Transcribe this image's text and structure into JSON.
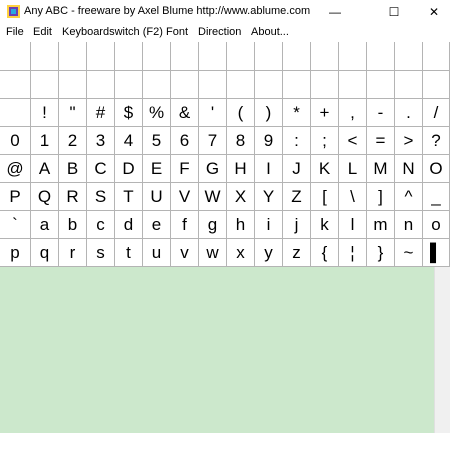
{
  "window": {
    "title": "Any ABC - freeware by Axel Blume http://www.ablume.com",
    "controls": {
      "minimize": "—",
      "maximize": "☐",
      "close": "✕"
    }
  },
  "menu": [
    "File",
    "Edit",
    "Keyboardswitch (F2)",
    "Font",
    "Direction",
    "About..."
  ],
  "grid": {
    "rows": [
      [
        "",
        "",
        "",
        "",
        "",
        "",
        "",
        "",
        "",
        "",
        "",
        "",
        "",
        "",
        "",
        ""
      ],
      [
        "",
        "",
        "",
        "",
        "",
        "",
        "",
        "",
        "",
        "",
        "",
        "",
        "",
        "",
        "",
        ""
      ],
      [
        "",
        "!",
        "\"",
        "#",
        "$",
        "%",
        "&",
        "'",
        "(",
        ")",
        "*",
        "+",
        ",",
        "-",
        ".",
        "/"
      ],
      [
        "0",
        "1",
        "2",
        "3",
        "4",
        "5",
        "6",
        "7",
        "8",
        "9",
        ":",
        ";",
        "<",
        "=",
        ">",
        "?"
      ],
      [
        "@",
        "A",
        "B",
        "C",
        "D",
        "E",
        "F",
        "G",
        "H",
        "I",
        "J",
        "K",
        "L",
        "M",
        "N",
        "O"
      ],
      [
        "P",
        "Q",
        "R",
        "S",
        "T",
        "U",
        "V",
        "W",
        "X",
        "Y",
        "Z",
        "[",
        "\\",
        "]",
        "^",
        "_"
      ],
      [
        "`",
        "a",
        "b",
        "c",
        "d",
        "e",
        "f",
        "g",
        "h",
        "i",
        "j",
        "k",
        "l",
        "m",
        "n",
        "o"
      ],
      [
        "p",
        "q",
        "r",
        "s",
        "t",
        "u",
        "v",
        "w",
        "x",
        "y",
        "z",
        "{",
        "¦",
        "}",
        "~",
        "▌"
      ]
    ]
  },
  "editor": {
    "text": "",
    "background": "#cce8cc"
  }
}
